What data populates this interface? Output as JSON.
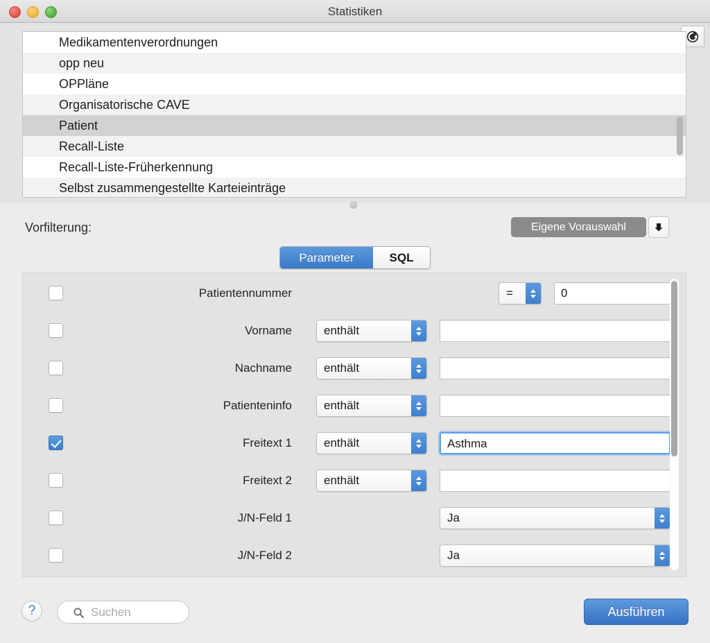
{
  "window": {
    "title": "Statistiken",
    "traffic_lights": [
      "close",
      "minimize",
      "maximize"
    ]
  },
  "toolbar": {
    "refresh_icon": "refresh-circular-arrow-icon"
  },
  "list": {
    "items": [
      {
        "label": "Medikamentenverordnungen",
        "selected": false
      },
      {
        "label": "opp neu",
        "selected": false
      },
      {
        "label": "OPPläne",
        "selected": false
      },
      {
        "label": "Organisatorische CAVE",
        "selected": false
      },
      {
        "label": "Patient",
        "selected": true
      },
      {
        "label": "Recall-Liste",
        "selected": false
      },
      {
        "label": "Recall-Liste-Früherkennung",
        "selected": false
      },
      {
        "label": "Selbst zusammengestellte Karteieinträge",
        "selected": false
      }
    ],
    "selected_item": "Patient"
  },
  "prefilter": {
    "label": "Vorfilterung:",
    "preset_button": "Eigene Vorauswahl",
    "preset_menu_icon": "download-arrow-icon"
  },
  "tabs": {
    "items": [
      {
        "label": "Parameter",
        "active": true
      },
      {
        "label": "SQL",
        "active": false
      }
    ],
    "active": "Parameter"
  },
  "form": {
    "rows": [
      {
        "label": "Patientennummer",
        "checked": false,
        "operator": "=",
        "operator_width": "narrow",
        "control": "textfield",
        "value": "0",
        "focused": false
      },
      {
        "label": "Vorname",
        "checked": false,
        "operator": "enthält",
        "operator_width": "wide",
        "control": "textfield",
        "value": "",
        "focused": false
      },
      {
        "label": "Nachname",
        "checked": false,
        "operator": "enthält",
        "operator_width": "wide",
        "control": "textfield",
        "value": "",
        "focused": false
      },
      {
        "label": "Patienteninfo",
        "checked": false,
        "operator": "enthält",
        "operator_width": "wide",
        "control": "textfield",
        "value": "",
        "focused": false
      },
      {
        "label": "Freitext 1",
        "checked": true,
        "operator": "enthält",
        "operator_width": "wide",
        "control": "textfield",
        "value": "Asthma",
        "focused": true
      },
      {
        "label": "Freitext 2",
        "checked": false,
        "operator": "enthält",
        "operator_width": "wide",
        "control": "textfield",
        "value": "",
        "focused": false
      },
      {
        "label": "J/N-Feld 1",
        "checked": false,
        "operator": null,
        "operator_width": null,
        "control": "popup",
        "value": "Ja",
        "focused": false
      },
      {
        "label": "J/N-Feld 2",
        "checked": false,
        "operator": null,
        "operator_width": null,
        "control": "popup",
        "value": "Ja",
        "focused": false
      }
    ]
  },
  "footer": {
    "help_label": "?",
    "search_placeholder": "Suchen",
    "search_value": "",
    "search_icon": "magnifier-icon",
    "execute_label": "Ausführen"
  },
  "colors": {
    "accent_blue": "#3f7fcd",
    "window_bg": "#ececec",
    "panel_bg": "#e3e3e3",
    "list_bg": "#ffffff",
    "selection_gray": "#d2d2d2",
    "disabled_pill_gray": "#8b8b8b"
  }
}
